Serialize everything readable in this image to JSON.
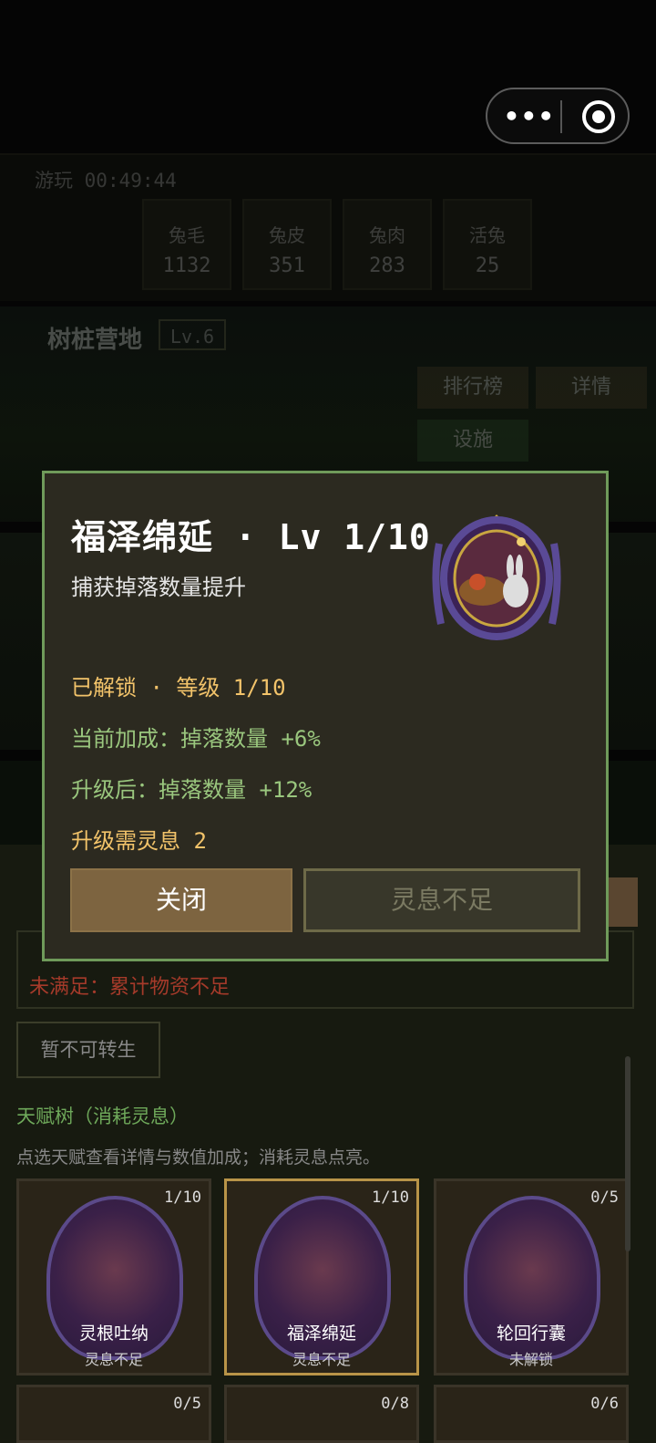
{
  "miniprogram": {
    "more_glyph": "•••"
  },
  "header": {
    "status_label": "游玩",
    "timer": "00:49:44"
  },
  "resources": [
    {
      "name": "兔毛",
      "value": "1132"
    },
    {
      "name": "兔皮",
      "value": "351"
    },
    {
      "name": "兔肉",
      "value": "283"
    },
    {
      "name": "活兔",
      "value": "25"
    }
  ],
  "camp": {
    "title": "树桩营地",
    "level": "Lv.6",
    "buttons": [
      "排行榜",
      "详情",
      "设施"
    ]
  },
  "lower": {
    "requirement_status": "未满足：累计物资不足",
    "rebirth_button": "暂不可转生",
    "tree_title": "天赋树（消耗灵息）",
    "tree_desc": "点选天赋查看详情与数值加成；消耗灵息点亮。",
    "talents": [
      {
        "name": "灵根吐纳",
        "count": "1/10",
        "status": "灵息不足"
      },
      {
        "name": "福泽绵延",
        "count": "1/10",
        "status": "灵息不足"
      },
      {
        "name": "轮回行囊",
        "count": "0/5",
        "status": "未解锁"
      }
    ],
    "talents_row2_counts": [
      "0/5",
      "0/8",
      "0/6"
    ]
  },
  "dialog": {
    "title": "福泽绵延 · Lv 1/10",
    "subtitle": "捕获掉落数量提升",
    "lines": [
      "已解锁 · 等级 1/10",
      "当前加成：掉落数量 +6%",
      "升级后：掉落数量 +12%",
      "升级需灵息 2"
    ],
    "close_button": "关闭",
    "action_button": "灵息不足",
    "emblem_icon": "rabbit-basket-emblem-icon"
  },
  "colors": {
    "dialog_border": "#6f9a5a",
    "gold_text": "#f2c36a",
    "green_text": "#9ac77e",
    "close_button": "#7d6440"
  }
}
